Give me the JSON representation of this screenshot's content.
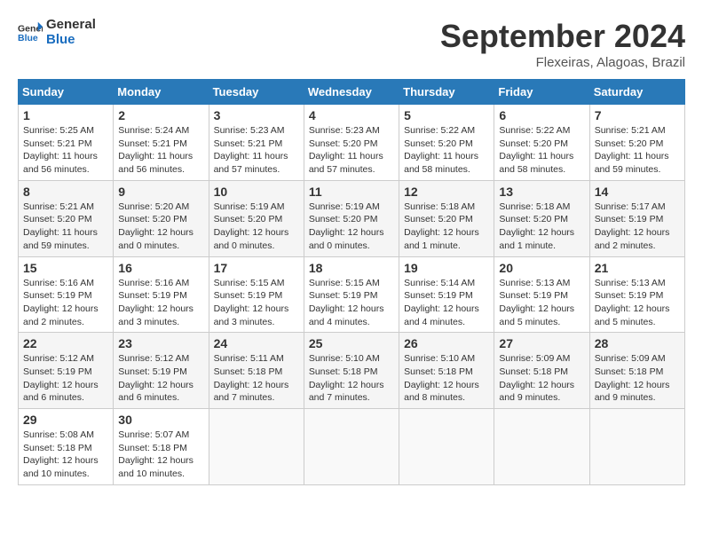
{
  "header": {
    "logo_line1": "General",
    "logo_line2": "Blue",
    "month": "September 2024",
    "location": "Flexeiras, Alagoas, Brazil"
  },
  "weekdays": [
    "Sunday",
    "Monday",
    "Tuesday",
    "Wednesday",
    "Thursday",
    "Friday",
    "Saturday"
  ],
  "weeks": [
    [
      {
        "day": "1",
        "info": "Sunrise: 5:25 AM\nSunset: 5:21 PM\nDaylight: 11 hours\nand 56 minutes."
      },
      {
        "day": "2",
        "info": "Sunrise: 5:24 AM\nSunset: 5:21 PM\nDaylight: 11 hours\nand 56 minutes."
      },
      {
        "day": "3",
        "info": "Sunrise: 5:23 AM\nSunset: 5:21 PM\nDaylight: 11 hours\nand 57 minutes."
      },
      {
        "day": "4",
        "info": "Sunrise: 5:23 AM\nSunset: 5:20 PM\nDaylight: 11 hours\nand 57 minutes."
      },
      {
        "day": "5",
        "info": "Sunrise: 5:22 AM\nSunset: 5:20 PM\nDaylight: 11 hours\nand 58 minutes."
      },
      {
        "day": "6",
        "info": "Sunrise: 5:22 AM\nSunset: 5:20 PM\nDaylight: 11 hours\nand 58 minutes."
      },
      {
        "day": "7",
        "info": "Sunrise: 5:21 AM\nSunset: 5:20 PM\nDaylight: 11 hours\nand 59 minutes."
      }
    ],
    [
      {
        "day": "8",
        "info": "Sunrise: 5:21 AM\nSunset: 5:20 PM\nDaylight: 11 hours\nand 59 minutes."
      },
      {
        "day": "9",
        "info": "Sunrise: 5:20 AM\nSunset: 5:20 PM\nDaylight: 12 hours\nand 0 minutes."
      },
      {
        "day": "10",
        "info": "Sunrise: 5:19 AM\nSunset: 5:20 PM\nDaylight: 12 hours\nand 0 minutes."
      },
      {
        "day": "11",
        "info": "Sunrise: 5:19 AM\nSunset: 5:20 PM\nDaylight: 12 hours\nand 0 minutes."
      },
      {
        "day": "12",
        "info": "Sunrise: 5:18 AM\nSunset: 5:20 PM\nDaylight: 12 hours\nand 1 minute."
      },
      {
        "day": "13",
        "info": "Sunrise: 5:18 AM\nSunset: 5:20 PM\nDaylight: 12 hours\nand 1 minute."
      },
      {
        "day": "14",
        "info": "Sunrise: 5:17 AM\nSunset: 5:19 PM\nDaylight: 12 hours\nand 2 minutes."
      }
    ],
    [
      {
        "day": "15",
        "info": "Sunrise: 5:16 AM\nSunset: 5:19 PM\nDaylight: 12 hours\nand 2 minutes."
      },
      {
        "day": "16",
        "info": "Sunrise: 5:16 AM\nSunset: 5:19 PM\nDaylight: 12 hours\nand 3 minutes."
      },
      {
        "day": "17",
        "info": "Sunrise: 5:15 AM\nSunset: 5:19 PM\nDaylight: 12 hours\nand 3 minutes."
      },
      {
        "day": "18",
        "info": "Sunrise: 5:15 AM\nSunset: 5:19 PM\nDaylight: 12 hours\nand 4 minutes."
      },
      {
        "day": "19",
        "info": "Sunrise: 5:14 AM\nSunset: 5:19 PM\nDaylight: 12 hours\nand 4 minutes."
      },
      {
        "day": "20",
        "info": "Sunrise: 5:13 AM\nSunset: 5:19 PM\nDaylight: 12 hours\nand 5 minutes."
      },
      {
        "day": "21",
        "info": "Sunrise: 5:13 AM\nSunset: 5:19 PM\nDaylight: 12 hours\nand 5 minutes."
      }
    ],
    [
      {
        "day": "22",
        "info": "Sunrise: 5:12 AM\nSunset: 5:19 PM\nDaylight: 12 hours\nand 6 minutes."
      },
      {
        "day": "23",
        "info": "Sunrise: 5:12 AM\nSunset: 5:19 PM\nDaylight: 12 hours\nand 6 minutes."
      },
      {
        "day": "24",
        "info": "Sunrise: 5:11 AM\nSunset: 5:18 PM\nDaylight: 12 hours\nand 7 minutes."
      },
      {
        "day": "25",
        "info": "Sunrise: 5:10 AM\nSunset: 5:18 PM\nDaylight: 12 hours\nand 7 minutes."
      },
      {
        "day": "26",
        "info": "Sunrise: 5:10 AM\nSunset: 5:18 PM\nDaylight: 12 hours\nand 8 minutes."
      },
      {
        "day": "27",
        "info": "Sunrise: 5:09 AM\nSunset: 5:18 PM\nDaylight: 12 hours\nand 9 minutes."
      },
      {
        "day": "28",
        "info": "Sunrise: 5:09 AM\nSunset: 5:18 PM\nDaylight: 12 hours\nand 9 minutes."
      }
    ],
    [
      {
        "day": "29",
        "info": "Sunrise: 5:08 AM\nSunset: 5:18 PM\nDaylight: 12 hours\nand 10 minutes."
      },
      {
        "day": "30",
        "info": "Sunrise: 5:07 AM\nSunset: 5:18 PM\nDaylight: 12 hours\nand 10 minutes."
      },
      {
        "day": "",
        "info": ""
      },
      {
        "day": "",
        "info": ""
      },
      {
        "day": "",
        "info": ""
      },
      {
        "day": "",
        "info": ""
      },
      {
        "day": "",
        "info": ""
      }
    ]
  ]
}
